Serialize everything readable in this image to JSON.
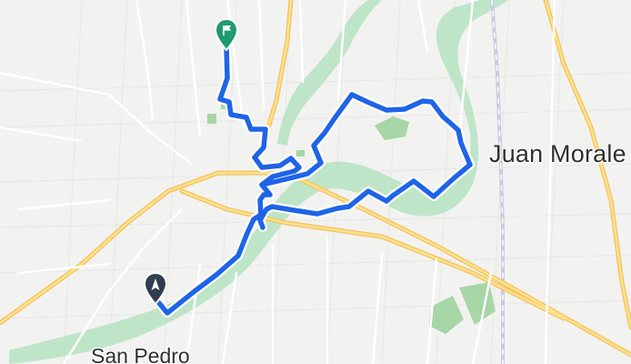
{
  "map": {
    "labels": {
      "east_town": "Juan Morale",
      "south_town": "San Pedro"
    },
    "markers": {
      "start": {
        "icon": "start-pin-icon",
        "color": "#2f3e51"
      },
      "finish": {
        "icon": "finish-flag-icon",
        "color": "#1f9a73"
      }
    },
    "colors": {
      "background": "#f2f2f0",
      "route": "#1e64e8",
      "river": "#b9e3c4",
      "park": "#a7d6a7",
      "major_road": "#f2c35a",
      "minor_road": "#ffffff",
      "rail": "#c8cde3"
    }
  }
}
